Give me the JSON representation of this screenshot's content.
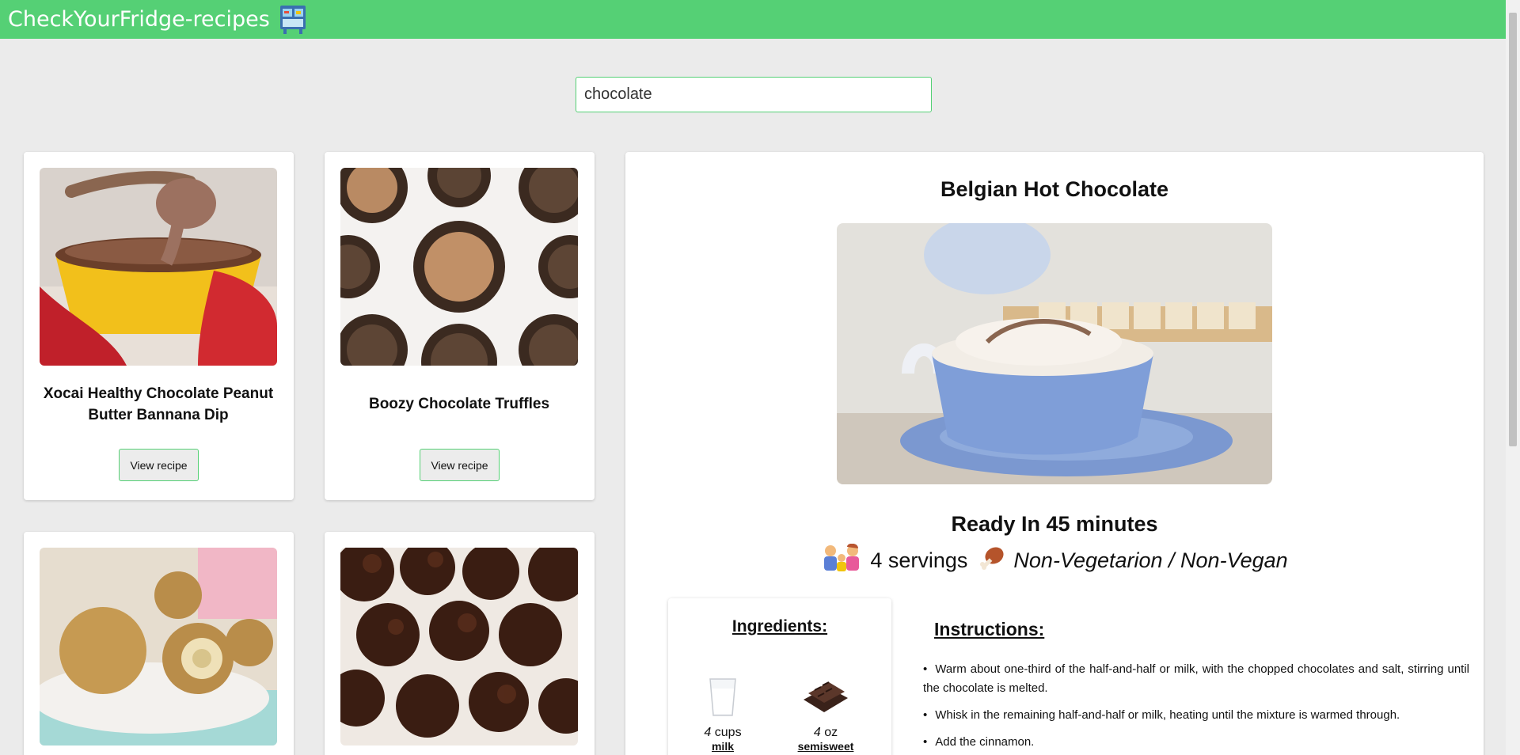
{
  "header": {
    "title": "CheckYourFridge-recipes",
    "icon": "fridge-icon",
    "bg_color": "#55d075"
  },
  "search": {
    "value": "chocolate"
  },
  "recipes": [
    {
      "title": "Xocai Healthy Chocolate Peanut Butter Bannana Dip",
      "button": "View recipe"
    },
    {
      "title": "Boozy Chocolate Truffles",
      "button": "View recipe"
    },
    {
      "title": "",
      "button": ""
    },
    {
      "title": "",
      "button": ""
    }
  ],
  "detail": {
    "title": "Belgian Hot Chocolate",
    "ready": "Ready In 45 minutes",
    "servings": "4 servings",
    "diet": "Non-Vegetarion / Non-Vegan",
    "ingredients_heading": "Ingredients:",
    "ingredients": [
      {
        "qty": "4",
        "unit": "cups",
        "name": "milk"
      },
      {
        "qty": "4",
        "unit": "oz",
        "name": "semisweet"
      }
    ],
    "instructions_heading": "Instructions:",
    "instructions": [
      "Warm about one-third of the half-and-half or milk, with the chopped chocolates and salt, stirring until the chocolate is melted.",
      "Whisk in the remaining half-and-half or milk, heating until the mixture is warmed through.",
      "Add the cinnamon."
    ]
  }
}
